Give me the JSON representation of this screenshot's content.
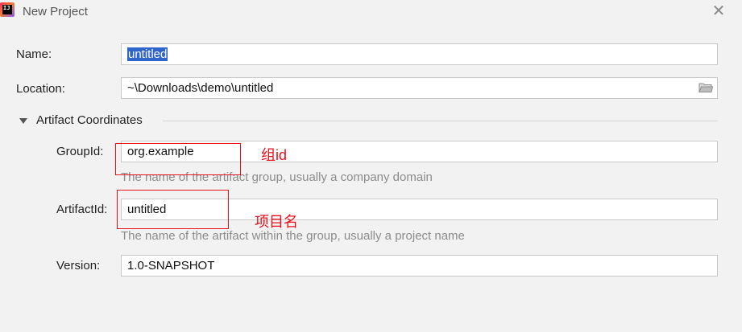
{
  "window": {
    "title": "New Project",
    "app_icon_text": "IJ",
    "close_symbol": "✕"
  },
  "form": {
    "name_label": "Name:",
    "name_value": "untitled",
    "location_label": "Location:",
    "location_value": "~\\Downloads\\demo\\untitled",
    "artifact_section_label": "Artifact Coordinates",
    "groupid_label": "GroupId:",
    "groupid_value": "org.example",
    "groupid_hint": "The name of the artifact group, usually a company domain",
    "artifactid_label": "ArtifactId:",
    "artifactid_value": "untitled",
    "artifactid_hint": "The name of the artifact within the group, usually a project name",
    "version_label": "Version:",
    "version_value": "1.0-SNAPSHOT"
  },
  "annotations": {
    "groupid_note": "组id",
    "artifactid_note": "项目名",
    "highlight_color": "#e8101a"
  },
  "icons": {
    "app": "intellij-idea-icon",
    "close": "close-icon",
    "folder": "folder-icon",
    "collapse": "triangle-down-icon"
  }
}
